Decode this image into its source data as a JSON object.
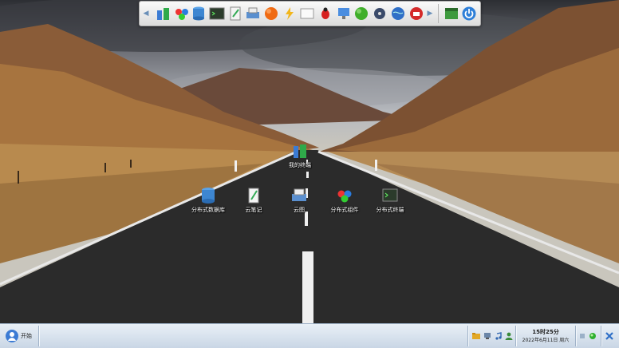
{
  "dock": {
    "icons": [
      "network-map-icon",
      "colorful-app-icon",
      "database-icon",
      "terminal-icon",
      "notepad-icon",
      "printer-icon",
      "orange-ball-icon",
      "lightning-icon",
      "blank-window-icon",
      "bug-icon",
      "monitor-icon",
      "green-ball-icon",
      "disc-icon",
      "globe-icon",
      "phone-icon"
    ],
    "extra_icons": [
      "window-icon",
      "power-icon"
    ]
  },
  "desktop": {
    "shortcuts": [
      {
        "label": "我的终端",
        "icon": "network-map-icon"
      },
      {
        "label": "分布式数据库",
        "icon": "database-icon"
      },
      {
        "label": "云笔记",
        "icon": "notepad-icon"
      },
      {
        "label": "云图",
        "icon": "printer-icon"
      },
      {
        "label": "分布式组件",
        "icon": "colorful-app-icon"
      },
      {
        "label": "分布式终端",
        "icon": "terminal-icon"
      }
    ]
  },
  "taskbar": {
    "start_label": "开始",
    "tray_icons": [
      "folder-icon",
      "computer-icon",
      "music-icon",
      "user-icon"
    ],
    "time": "15时25分",
    "date": "2022年6月11日  周六",
    "right_icons": [
      "network-icon",
      "green-status-icon",
      "desktop-toggle-icon"
    ]
  },
  "colors": {
    "taskbar_top": "#e9f0f7",
    "taskbar_bottom": "#c9d6e5",
    "road": "#2b2b2b",
    "hills": "#8a5a33"
  }
}
